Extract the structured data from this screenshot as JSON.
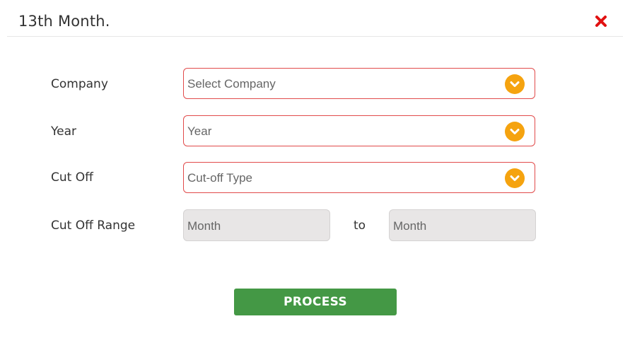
{
  "header": {
    "title": "13th Month.",
    "close_icon": "close-icon",
    "close_color": "#e11111"
  },
  "form": {
    "company": {
      "label": "Company",
      "value": "Select Company"
    },
    "year": {
      "label": "Year",
      "value": "Year"
    },
    "cutoff": {
      "label": "Cut Off",
      "value": "Cut-off Type"
    },
    "cutoff_range": {
      "label": "Cut Off Range",
      "from_value": "Month",
      "separator": "to",
      "to_value": "Month"
    }
  },
  "actions": {
    "process_label": "PROCESS",
    "process_color": "#449845"
  },
  "colors": {
    "select_border": "#e14b4b",
    "chevron_badge": "#f5a30f",
    "disabled_bg": "#e8e6e6"
  }
}
